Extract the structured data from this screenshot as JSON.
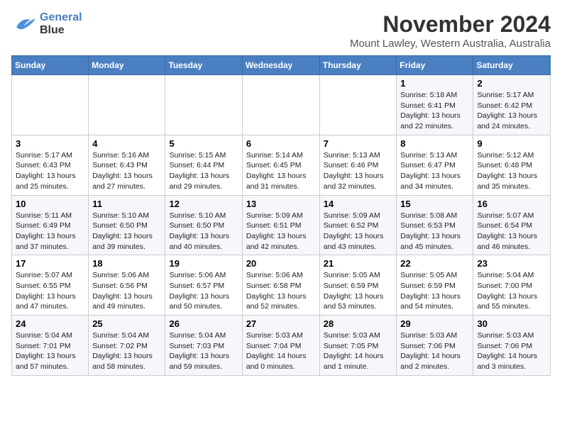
{
  "header": {
    "logo_line1": "General",
    "logo_line2": "Blue",
    "title": "November 2024",
    "subtitle": "Mount Lawley, Western Australia, Australia"
  },
  "weekdays": [
    "Sunday",
    "Monday",
    "Tuesday",
    "Wednesday",
    "Thursday",
    "Friday",
    "Saturday"
  ],
  "weeks": [
    [
      {
        "day": "",
        "info": ""
      },
      {
        "day": "",
        "info": ""
      },
      {
        "day": "",
        "info": ""
      },
      {
        "day": "",
        "info": ""
      },
      {
        "day": "",
        "info": ""
      },
      {
        "day": "1",
        "info": "Sunrise: 5:18 AM\nSunset: 6:41 PM\nDaylight: 13 hours\nand 22 minutes."
      },
      {
        "day": "2",
        "info": "Sunrise: 5:17 AM\nSunset: 6:42 PM\nDaylight: 13 hours\nand 24 minutes."
      }
    ],
    [
      {
        "day": "3",
        "info": "Sunrise: 5:17 AM\nSunset: 6:43 PM\nDaylight: 13 hours\nand 25 minutes."
      },
      {
        "day": "4",
        "info": "Sunrise: 5:16 AM\nSunset: 6:43 PM\nDaylight: 13 hours\nand 27 minutes."
      },
      {
        "day": "5",
        "info": "Sunrise: 5:15 AM\nSunset: 6:44 PM\nDaylight: 13 hours\nand 29 minutes."
      },
      {
        "day": "6",
        "info": "Sunrise: 5:14 AM\nSunset: 6:45 PM\nDaylight: 13 hours\nand 31 minutes."
      },
      {
        "day": "7",
        "info": "Sunrise: 5:13 AM\nSunset: 6:46 PM\nDaylight: 13 hours\nand 32 minutes."
      },
      {
        "day": "8",
        "info": "Sunrise: 5:13 AM\nSunset: 6:47 PM\nDaylight: 13 hours\nand 34 minutes."
      },
      {
        "day": "9",
        "info": "Sunrise: 5:12 AM\nSunset: 6:48 PM\nDaylight: 13 hours\nand 35 minutes."
      }
    ],
    [
      {
        "day": "10",
        "info": "Sunrise: 5:11 AM\nSunset: 6:49 PM\nDaylight: 13 hours\nand 37 minutes."
      },
      {
        "day": "11",
        "info": "Sunrise: 5:10 AM\nSunset: 6:50 PM\nDaylight: 13 hours\nand 39 minutes."
      },
      {
        "day": "12",
        "info": "Sunrise: 5:10 AM\nSunset: 6:50 PM\nDaylight: 13 hours\nand 40 minutes."
      },
      {
        "day": "13",
        "info": "Sunrise: 5:09 AM\nSunset: 6:51 PM\nDaylight: 13 hours\nand 42 minutes."
      },
      {
        "day": "14",
        "info": "Sunrise: 5:09 AM\nSunset: 6:52 PM\nDaylight: 13 hours\nand 43 minutes."
      },
      {
        "day": "15",
        "info": "Sunrise: 5:08 AM\nSunset: 6:53 PM\nDaylight: 13 hours\nand 45 minutes."
      },
      {
        "day": "16",
        "info": "Sunrise: 5:07 AM\nSunset: 6:54 PM\nDaylight: 13 hours\nand 46 minutes."
      }
    ],
    [
      {
        "day": "17",
        "info": "Sunrise: 5:07 AM\nSunset: 6:55 PM\nDaylight: 13 hours\nand 47 minutes."
      },
      {
        "day": "18",
        "info": "Sunrise: 5:06 AM\nSunset: 6:56 PM\nDaylight: 13 hours\nand 49 minutes."
      },
      {
        "day": "19",
        "info": "Sunrise: 5:06 AM\nSunset: 6:57 PM\nDaylight: 13 hours\nand 50 minutes."
      },
      {
        "day": "20",
        "info": "Sunrise: 5:06 AM\nSunset: 6:58 PM\nDaylight: 13 hours\nand 52 minutes."
      },
      {
        "day": "21",
        "info": "Sunrise: 5:05 AM\nSunset: 6:59 PM\nDaylight: 13 hours\nand 53 minutes."
      },
      {
        "day": "22",
        "info": "Sunrise: 5:05 AM\nSunset: 6:59 PM\nDaylight: 13 hours\nand 54 minutes."
      },
      {
        "day": "23",
        "info": "Sunrise: 5:04 AM\nSunset: 7:00 PM\nDaylight: 13 hours\nand 55 minutes."
      }
    ],
    [
      {
        "day": "24",
        "info": "Sunrise: 5:04 AM\nSunset: 7:01 PM\nDaylight: 13 hours\nand 57 minutes."
      },
      {
        "day": "25",
        "info": "Sunrise: 5:04 AM\nSunset: 7:02 PM\nDaylight: 13 hours\nand 58 minutes."
      },
      {
        "day": "26",
        "info": "Sunrise: 5:04 AM\nSunset: 7:03 PM\nDaylight: 13 hours\nand 59 minutes."
      },
      {
        "day": "27",
        "info": "Sunrise: 5:03 AM\nSunset: 7:04 PM\nDaylight: 14 hours\nand 0 minutes."
      },
      {
        "day": "28",
        "info": "Sunrise: 5:03 AM\nSunset: 7:05 PM\nDaylight: 14 hours\nand 1 minute."
      },
      {
        "day": "29",
        "info": "Sunrise: 5:03 AM\nSunset: 7:06 PM\nDaylight: 14 hours\nand 2 minutes."
      },
      {
        "day": "30",
        "info": "Sunrise: 5:03 AM\nSunset: 7:06 PM\nDaylight: 14 hours\nand 3 minutes."
      }
    ]
  ]
}
